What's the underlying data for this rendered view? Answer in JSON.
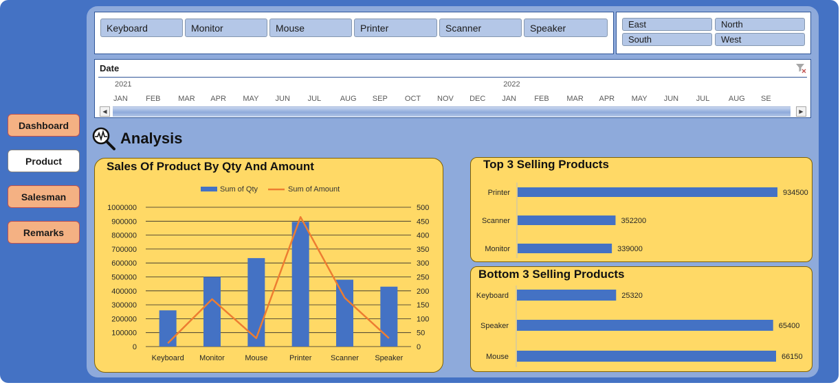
{
  "nav": {
    "items": [
      {
        "label": "Dashboard",
        "active": false
      },
      {
        "label": "Product",
        "active": true
      },
      {
        "label": "Salesman",
        "active": false
      },
      {
        "label": "Remarks",
        "active": false
      }
    ]
  },
  "product_slicer": {
    "items": [
      "Keyboard",
      "Monitor",
      "Mouse",
      "Printer",
      "Scanner",
      "Speaker"
    ]
  },
  "region_slicer": {
    "items": [
      "East",
      "North",
      "South",
      "West"
    ]
  },
  "timeline": {
    "title": "Date",
    "years": [
      "2021",
      "2022"
    ],
    "months": [
      "JAN",
      "FEB",
      "MAR",
      "APR",
      "MAY",
      "JUN",
      "JUL",
      "AUG",
      "SEP",
      "OCT",
      "NOV",
      "DEC",
      "JAN",
      "FEB",
      "MAR",
      "APR",
      "MAY",
      "JUN",
      "JUL",
      "AUG",
      "SE"
    ]
  },
  "section": {
    "title": "Analysis"
  },
  "chart_data": [
    {
      "type": "bar",
      "title": "Sales Of Product By Qty And Amount",
      "categories": [
        "Keyboard",
        "Monitor",
        "Mouse",
        "Printer",
        "Scanner",
        "Speaker"
      ],
      "series": [
        {
          "name": "Sum of Qty",
          "type": "bar",
          "axis": "left",
          "color": "#4472c4",
          "values": [
            260000,
            500000,
            635000,
            895000,
            480000,
            430000
          ]
        },
        {
          "name": "Sum of Amount",
          "type": "line",
          "axis": "right",
          "color": "#ed7d31",
          "values": [
            12,
            170,
            30,
            465,
            175,
            30
          ]
        }
      ],
      "y_left_ticks": [
        "1000000",
        "900000",
        "800000",
        "700000",
        "600000",
        "500000",
        "400000",
        "300000",
        "200000",
        "100000",
        "0"
      ],
      "y_right_ticks": [
        "500",
        "450",
        "400",
        "350",
        "300",
        "250",
        "200",
        "150",
        "100",
        "50",
        "0"
      ],
      "ylim_left": [
        0,
        1000000
      ],
      "ylim_right": [
        0,
        500
      ],
      "legend": "top",
      "grid": true
    },
    {
      "type": "bar",
      "orientation": "horizontal",
      "title": "Top 3 Selling Products",
      "categories": [
        "Printer",
        "Scanner",
        "Monitor"
      ],
      "values": [
        934500,
        352200,
        339000
      ],
      "labels": [
        "934500",
        "352200",
        "339000"
      ],
      "max": 934500,
      "color": "#4472c4"
    },
    {
      "type": "bar",
      "orientation": "horizontal",
      "title": "Bottom 3 Selling Products",
      "categories": [
        "Keyboard",
        "Speaker",
        "Mouse"
      ],
      "values": [
        25320,
        65400,
        66150
      ],
      "labels": [
        "25320",
        "65400",
        "66150"
      ],
      "max": 66150,
      "color": "#4472c4"
    }
  ]
}
